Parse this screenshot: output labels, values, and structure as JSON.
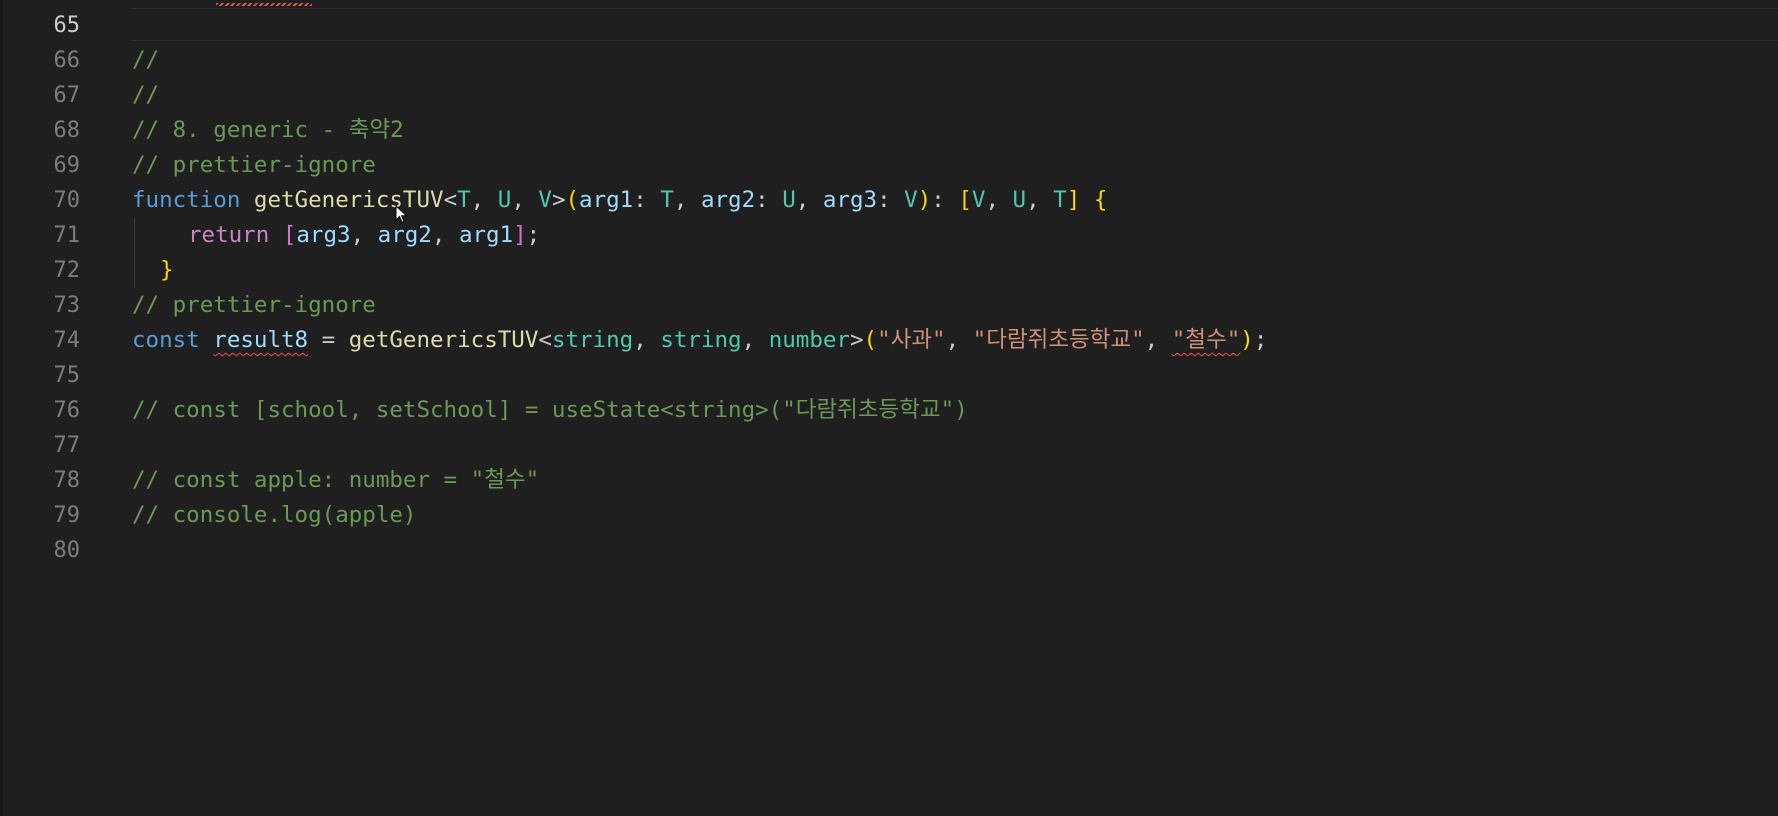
{
  "editor": {
    "lines": [
      {
        "n": "65"
      },
      {
        "n": "66"
      },
      {
        "n": "67"
      },
      {
        "n": "68"
      },
      {
        "n": "69"
      },
      {
        "n": "70"
      },
      {
        "n": "71"
      },
      {
        "n": "72"
      },
      {
        "n": "73"
      },
      {
        "n": "74"
      },
      {
        "n": "75"
      },
      {
        "n": "76"
      },
      {
        "n": "77"
      },
      {
        "n": "78"
      },
      {
        "n": "79"
      },
      {
        "n": "80"
      }
    ],
    "code": {
      "l66": "//",
      "l67": "//",
      "l68": "// 8. generic - 축약2",
      "l69": "// prettier-ignore",
      "l70": {
        "kw": "function",
        "name": "getGenericsTUV",
        "lt": "<",
        "t1": "T",
        "c1": ", ",
        "t2": "U",
        "c2": ", ",
        "t3": "V",
        "gt": ">",
        "po": "(",
        "a1": "arg1",
        "col1": ": ",
        "a1t": "T",
        "c3": ", ",
        "a2": "arg2",
        "col2": ": ",
        "a2t": "U",
        "c4": ", ",
        "a3": "arg3",
        "col3": ": ",
        "a3t": "V",
        "pc": ")",
        "col4": ": ",
        "bo": "[",
        "r1": "V",
        "c5": ", ",
        "r2": "U",
        "c6": ", ",
        "r3": "T",
        "bc": "]",
        "sp": " ",
        "brace": "{"
      },
      "l71": {
        "kw": "return",
        "sp": " ",
        "bo": "[",
        "v1": "arg3",
        "c1": ", ",
        "v2": "arg2",
        "c2": ", ",
        "v3": "arg1",
        "bc": "]",
        "semi": ";"
      },
      "l72": "}",
      "l73": "// prettier-ignore",
      "l74": {
        "kw": "const",
        "sp": " ",
        "name": "result8",
        "eq": " = ",
        "fn": "getGenericsTUV",
        "lt": "<",
        "t1": "string",
        "c1": ", ",
        "t2": "string",
        "c2": ", ",
        "t3": "number",
        "gt": ">",
        "po": "(",
        "s1": "\"사과\"",
        "c3": ", ",
        "s2": "\"다람쥐초등학교\"",
        "c4": ", ",
        "s3": "\"철수\"",
        "pc": ")",
        "semi": ";"
      },
      "l76": "// const [school, setSchool] = useState<string>(\"다람쥐초등학교\")",
      "l78": "// const apple: number = \"철수\"",
      "l79": "// console.log(apple)"
    }
  }
}
